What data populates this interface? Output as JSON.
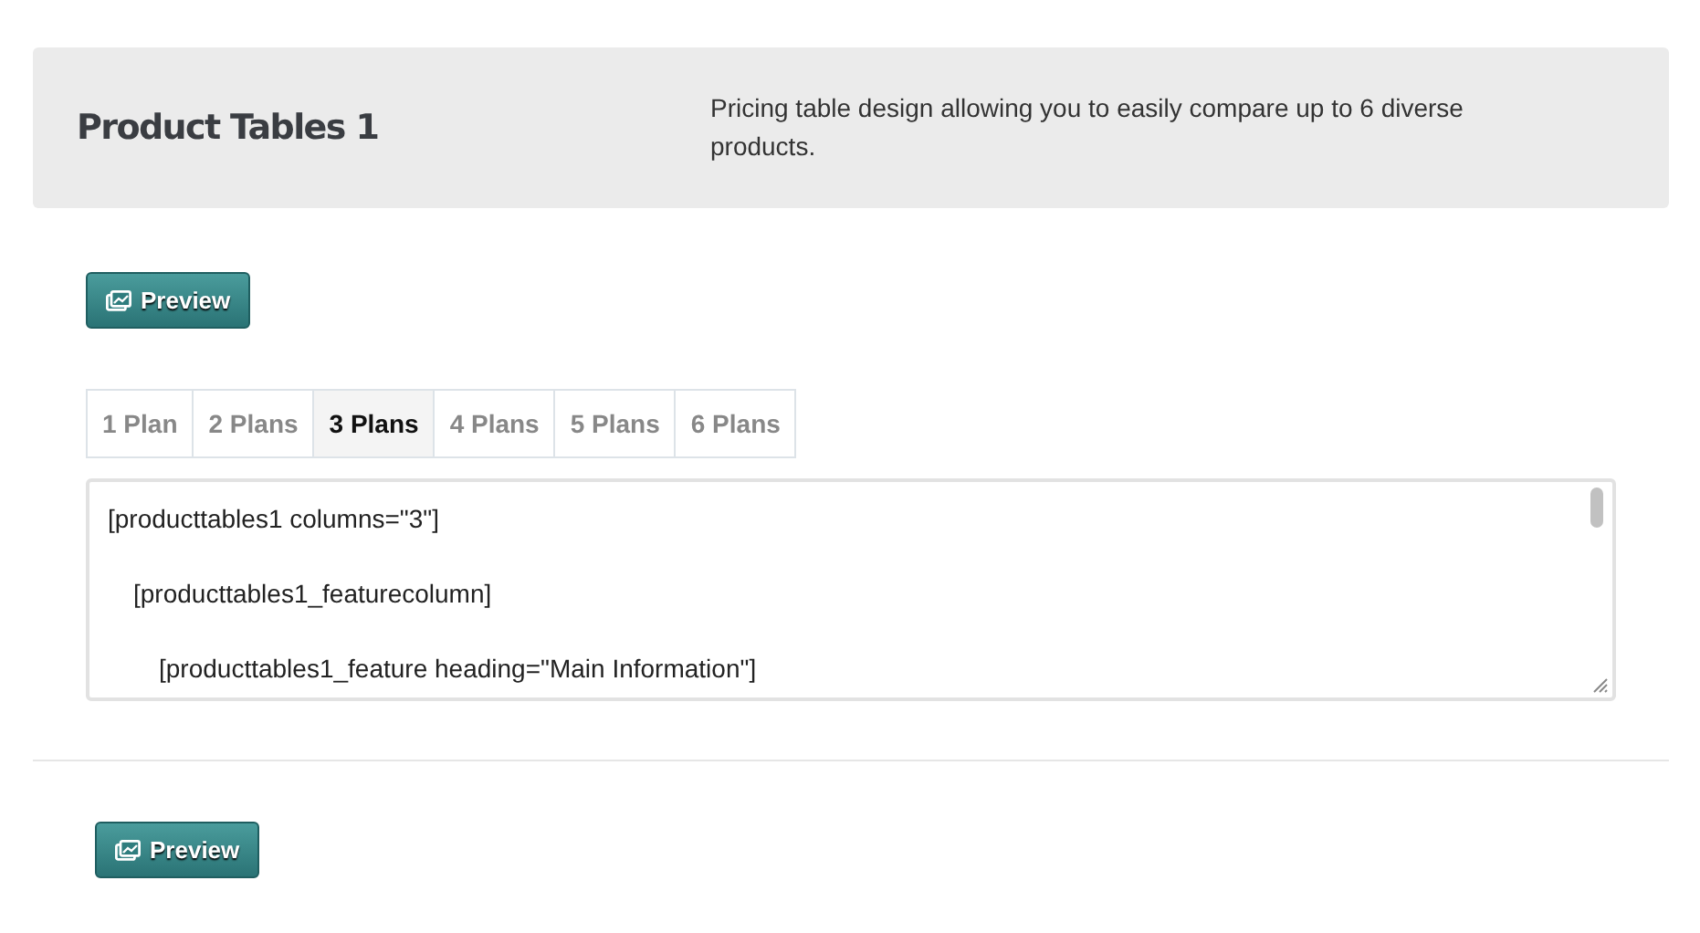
{
  "header": {
    "title": "Product Tables 1",
    "description": "Pricing table design allowing you to easily compare up to 6 diverse products."
  },
  "preview_button_top": {
    "label": "Preview"
  },
  "tabs": [
    {
      "label": "1 Plan",
      "selected": false
    },
    {
      "label": "2 Plans",
      "selected": false
    },
    {
      "label": "3 Plans",
      "selected": true
    },
    {
      "label": "4 Plans",
      "selected": false
    },
    {
      "label": "5 Plans",
      "selected": false
    },
    {
      "label": "6 Plans",
      "selected": false
    }
  ],
  "code_lines": [
    {
      "text": "[producttables1 columns=\"3\"]",
      "children": [
        {
          "text": "[producttables1_featurecolumn]",
          "children": [
            {
              "text": "[producttables1_feature heading=\"Main Information\"]"
            }
          ]
        }
      ]
    }
  ],
  "preview_button_bottom": {
    "label": "Preview"
  }
}
